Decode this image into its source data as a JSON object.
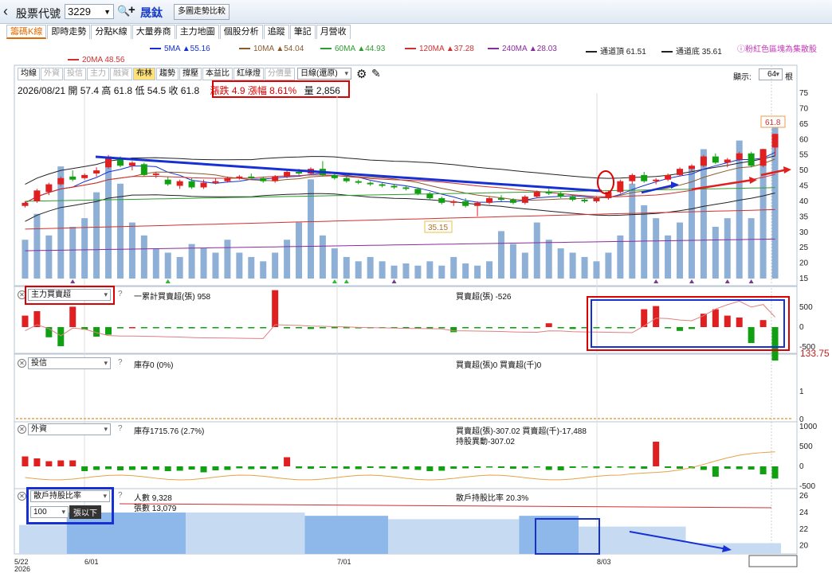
{
  "header": {
    "back_label": "‹",
    "title": "股票代號",
    "code": "3229",
    "stock_name": "晟鈦",
    "compare_button": "多圖走勢比較"
  },
  "tabs": [
    {
      "label": "籌碼K線",
      "active": true
    },
    {
      "label": "即時走勢"
    },
    {
      "label": "分點K線"
    },
    {
      "label": "大量券商"
    },
    {
      "label": "主力地圖"
    },
    {
      "label": "個股分析"
    },
    {
      "label": "追蹤"
    },
    {
      "label": "筆記"
    },
    {
      "label": "月營收"
    }
  ],
  "ma_legend": [
    {
      "label": "5MA ▲55.16",
      "color": "#1630d4"
    },
    {
      "label": "10MA ▲54.04",
      "color": "#8b5a2b"
    },
    {
      "label": "60MA ▲44.93",
      "color": "#2e9c2e"
    },
    {
      "label": "120MA ▲37.28",
      "color": "#d03030"
    },
    {
      "label": "240MA ▲28.03",
      "color": "#8a2c9e"
    },
    {
      "label": "通道頂 61.51",
      "color": "#222"
    },
    {
      "label": "通道底 35.61",
      "color": "#222"
    },
    {
      "label": "20MA 48.56",
      "color": "#d03030"
    }
  ],
  "legend_note": "ⓘ粉紅色區塊為集散股",
  "toolbar": {
    "buttons": [
      {
        "label": "均線"
      },
      {
        "label": "外資",
        "dim": true
      },
      {
        "label": "投信",
        "dim": true
      },
      {
        "label": "主力",
        "dim": true
      },
      {
        "label": "融資",
        "dim": true
      },
      {
        "label": "布林",
        "act": true
      },
      {
        "label": "趨勢"
      },
      {
        "label": "撐壓"
      },
      {
        "label": "本益比"
      },
      {
        "label": "紅綠燈"
      },
      {
        "label": "分價量",
        "dim": true
      }
    ],
    "period": "日線(還原)",
    "show_label": "顯示:",
    "show_value": "64",
    "show_unit": "根"
  },
  "ohlc": {
    "text": "2026/08/21 開 57.4 高 61.8 低 54.5 收 61.8",
    "change": "漲跌 4.9  漲幅 8.61%",
    "volume": "量 2,856"
  },
  "price_marks": {
    "high": "61.8",
    "low": "35.15"
  },
  "panels": {
    "main_force": {
      "select": "主力買賣超",
      "cum_label": "一累計買賣超(張) 958",
      "bs_label": "買賣超(張) -526",
      "right_value": "133.75"
    },
    "trust": {
      "select": "投信",
      "inv_label": "庫存0 (0%)",
      "bs_label": "買賣超(張)0 買賣超(千)0"
    },
    "foreign": {
      "select": "外資",
      "inv_label": "庫存1715.76 (2.7%)",
      "bs_label": "買賣超(張)-307.02 買賣超(千)-17,488",
      "change_label": "持股異動-307.02"
    },
    "holder": {
      "select": "散戶持股比率",
      "people": "人數 9,328",
      "shares": "張數 13,079",
      "ratio": "散戶持股比率 20.3%",
      "qty": "100",
      "qty_unit": "張以下"
    }
  },
  "axes": {
    "price_ticks": [
      "75",
      "70",
      "65",
      "60",
      "55",
      "50",
      "45",
      "40",
      "35",
      "30",
      "25",
      "20",
      "15"
    ],
    "mf_ticks": [
      "500",
      "0",
      "-500"
    ],
    "trust_ticks": [
      "1",
      "0"
    ],
    "foreign_ticks": [
      "1000",
      "500",
      "0",
      "-500"
    ],
    "holder_ticks": [
      "26",
      "24",
      "22",
      "20"
    ],
    "x_labels": [
      "5/22",
      "6/01",
      "7/01",
      "8/03",
      "2026/08/21"
    ],
    "year": "2026"
  },
  "chart_data": {
    "type": "candlestick",
    "dates_hint": "5/22 to 2026/08/21",
    "candles": [
      [
        38.5,
        40,
        38,
        39.5
      ],
      [
        40,
        44,
        39.5,
        43.5
      ],
      [
        43,
        46,
        42,
        45.5
      ],
      [
        45.5,
        48,
        45,
        47.5
      ],
      [
        48,
        50,
        46.5,
        47
      ],
      [
        47.5,
        49,
        47,
        48.5
      ],
      [
        49,
        51,
        48,
        50
      ],
      [
        51,
        55,
        50.5,
        54.5
      ],
      [
        54,
        54.5,
        51,
        51.5
      ],
      [
        51.5,
        53,
        50,
        52.5
      ],
      [
        52,
        52.5,
        48,
        48.5
      ],
      [
        48.5,
        49.5,
        47.5,
        49
      ],
      [
        47,
        48,
        45,
        45.5
      ],
      [
        45,
        47,
        44,
        46.5
      ],
      [
        46.5,
        47.5,
        44,
        44.5
      ],
      [
        44.5,
        47,
        44,
        46
      ],
      [
        46,
        47.5,
        45.5,
        46.5
      ],
      [
        46.5,
        48,
        46,
        47.5
      ],
      [
        47.5,
        48.5,
        47,
        48
      ],
      [
        48,
        49,
        47.5,
        47.5
      ],
      [
        47.5,
        48,
        46,
        46.5
      ],
      [
        46.5,
        48.5,
        46,
        48
      ],
      [
        48,
        50,
        47.5,
        49.5
      ],
      [
        49.5,
        50.5,
        48.5,
        49
      ],
      [
        49,
        51,
        48.5,
        50.5
      ],
      [
        50.5,
        53,
        48,
        48.5
      ],
      [
        48.5,
        49,
        47,
        47.5
      ],
      [
        47.5,
        48,
        46,
        46.5
      ],
      [
        46.5,
        47,
        45.5,
        46
      ],
      [
        46,
        46.5,
        45,
        45.5
      ],
      [
        45.5,
        46,
        44.5,
        45
      ],
      [
        45,
        45.5,
        44,
        44.5
      ],
      [
        44.5,
        45,
        43.5,
        44
      ],
      [
        44,
        44.5,
        42,
        42.5
      ],
      [
        42.5,
        43,
        40.5,
        41
      ],
      [
        41,
        41.5,
        39,
        39.5
      ],
      [
        39.5,
        40.5,
        38.5,
        40
      ],
      [
        40,
        41,
        38,
        38.5
      ],
      [
        38.5,
        40,
        35.15,
        39.5
      ],
      [
        39.5,
        41.5,
        39,
        41
      ],
      [
        41,
        42,
        40,
        40.5
      ],
      [
        40.5,
        41,
        39,
        39.5
      ],
      [
        39.5,
        42,
        39,
        41.5
      ],
      [
        41.5,
        43.5,
        41,
        43
      ],
      [
        43,
        44,
        42,
        42.5
      ],
      [
        42.5,
        43,
        41,
        41.5
      ],
      [
        41.5,
        42,
        40,
        40.5
      ],
      [
        40.5,
        41,
        39.5,
        40
      ],
      [
        40,
        41.5,
        39.5,
        41
      ],
      [
        41,
        43.5,
        40.5,
        43
      ],
      [
        43,
        47,
        42.5,
        46.5
      ],
      [
        46.5,
        49,
        45.5,
        48.5
      ],
      [
        48.5,
        49.5,
        46,
        46.5
      ],
      [
        46.5,
        47.5,
        45.5,
        47
      ],
      [
        47,
        49,
        46.5,
        48.5
      ],
      [
        48.5,
        51,
        48,
        50.5
      ],
      [
        50.5,
        52,
        49.5,
        51.5
      ],
      [
        51.5,
        55,
        51,
        54.5
      ],
      [
        54.5,
        55.5,
        52,
        52.5
      ],
      [
        52.5,
        54,
        51,
        53.5
      ],
      [
        53.5,
        56,
        53,
        55.5
      ],
      [
        55.5,
        56,
        51,
        51.5
      ],
      [
        51.5,
        57,
        51,
        56.9
      ],
      [
        57.4,
        61.8,
        54.5,
        61.8
      ]
    ],
    "volume": [
      900,
      1500,
      1000,
      2600,
      1200,
      1400,
      2000,
      2700,
      2200,
      1300,
      1000,
      700,
      600,
      500,
      800,
      700,
      600,
      900,
      600,
      500,
      400,
      600,
      900,
      1300,
      2300,
      1000,
      700,
      500,
      400,
      500,
      400,
      300,
      350,
      300,
      400,
      300,
      500,
      350,
      300,
      400,
      1100,
      800,
      600,
      1300,
      900,
      700,
      600,
      500,
      400,
      600,
      1000,
      2200,
      1700,
      1400,
      1000,
      1300,
      2600,
      3000,
      1200,
      1400,
      3200,
      1400,
      2900,
      3600
    ],
    "ylim": [
      15,
      75
    ],
    "mf_values": [
      180,
      250,
      -160,
      -300,
      320,
      -40,
      -150,
      -120,
      -20,
      0,
      -10,
      -10,
      -15,
      -10,
      -20,
      -10,
      -5,
      -5,
      -10,
      -5,
      -5,
      580,
      -20,
      -10,
      -30,
      -10,
      -15,
      -10,
      -20,
      -10,
      -5,
      -15,
      -10,
      -5,
      -10,
      -5,
      -80,
      -5,
      -10,
      -5,
      -10,
      -20,
      -10,
      -5,
      60,
      -5,
      -30,
      -10,
      -5,
      -10,
      -5,
      -10,
      280,
      330,
      -20,
      -60,
      -30,
      210,
      280,
      180,
      150,
      -250,
      110,
      -526
    ],
    "foreign_values": [
      250,
      200,
      130,
      150,
      150,
      -120,
      -90,
      -70,
      -100,
      -90,
      -80,
      -90,
      -120,
      -110,
      -80,
      -150,
      -100,
      -90,
      -50,
      -70,
      -60,
      -70,
      230,
      -50,
      -60,
      -40,
      -50,
      -60,
      -70,
      -40,
      -50,
      -60,
      -70,
      -90,
      -120,
      -110,
      -60,
      -50,
      -40,
      -30,
      -40,
      -60,
      -50,
      -30,
      -90,
      -100,
      -40,
      -30,
      -50,
      -40,
      -30,
      -50,
      -60,
      620,
      -40,
      -60,
      -50,
      -90,
      -260,
      -60,
      -70,
      -80,
      -200,
      -307.02
    ],
    "holder_segments": [
      [
        0,
        4,
        "#c6dbf2"
      ],
      [
        4,
        14,
        "#8fb8ea"
      ],
      [
        14,
        24,
        "#c6dbf2"
      ],
      [
        24,
        31,
        "#8fb8ea"
      ],
      [
        31,
        42,
        "#c6dbf2"
      ],
      [
        42,
        47,
        "#8fb8ea"
      ],
      [
        47,
        56,
        "#c6dbf2"
      ],
      [
        56,
        64,
        "#c6dbf2"
      ]
    ],
    "holder_ratio": [
      22.5,
      22.5,
      22.5,
      22.5,
      24,
      24,
      24,
      24,
      24,
      24,
      24,
      24,
      24,
      24,
      24,
      24,
      24,
      24,
      24,
      24,
      24,
      24,
      24,
      24,
      23.6,
      23.6,
      23.6,
      23.6,
      23.6,
      23.6,
      23.6,
      23.2,
      23.2,
      23.2,
      23.2,
      23.2,
      23.2,
      23.2,
      23.2,
      23.2,
      23.2,
      23.2,
      23.6,
      23.6,
      23.6,
      23.6,
      23.6,
      22.3,
      22.3,
      22.3,
      22.3,
      22.3,
      22.3,
      22.3,
      22.3,
      22.3,
      20.3,
      20.3,
      20.3,
      20.3,
      20.3,
      20.3,
      20.3,
      20.3
    ]
  }
}
